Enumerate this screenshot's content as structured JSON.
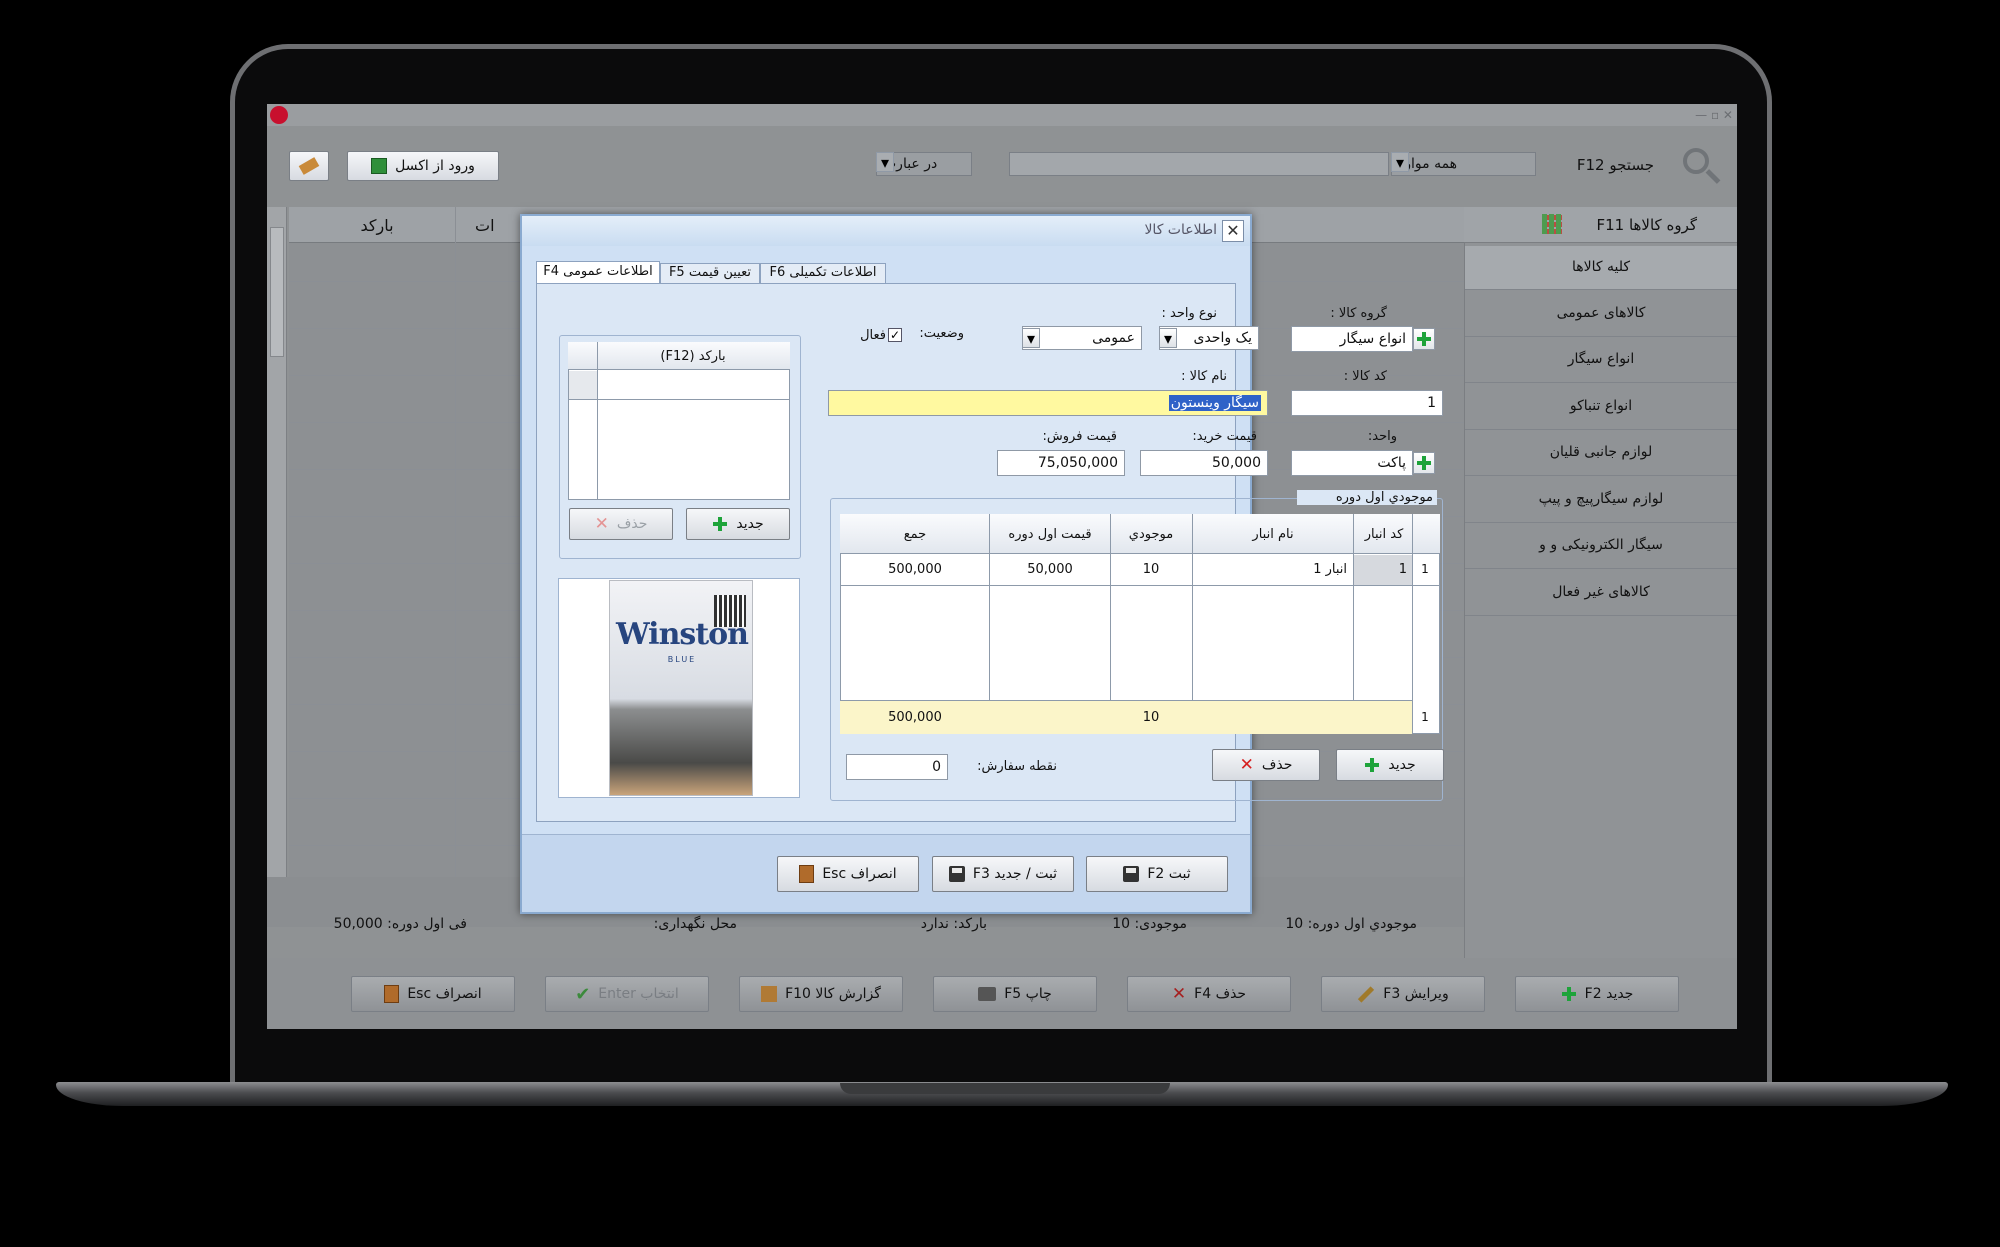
{
  "main_window": {
    "toolbar": {
      "excel_import_label": "ورود از اکسل",
      "search_label": "جستجو F12",
      "scope_value": "همه موارد",
      "match_value": "در عبارت",
      "search_value": ""
    },
    "grid_headers": [
      "بارکد",
      "ات"
    ],
    "groups_header": "گروه کالاها F11",
    "groups": [
      "کلیه کالاها",
      "کالاهای عمومی",
      "انواع سیگار",
      "انواع تنباکو",
      "لوازم جانبی قلیان",
      "لوازم سیگارپیچ و پیپ",
      "سیگار الکترونیکی و و",
      "کالاهای غیر فعال"
    ],
    "status": {
      "opening_stock": "موجودي اول دوره: 10",
      "stock": "موجودی: 10",
      "barcode": "بارکد: ندارد",
      "storage": "محل نگهداری:",
      "opening_price": "فی اول دوره: 50,000"
    },
    "buttons": {
      "new": "جدید F2",
      "edit": "ویرایش F3",
      "delete": "حذف F4",
      "print": "چاپ F5",
      "report": "گزارش کالا F10",
      "select": "انتخاب Enter",
      "cancel": "انصراف Esc"
    }
  },
  "dialog": {
    "title": "اطلاعات کالا",
    "tabs": [
      "اطلاعات عمومی F4",
      "تعیین قیمت F5",
      "اطلاعات تکمیلی F6"
    ],
    "group_label": "گروه کالا :",
    "group_value": "انواع سیگار",
    "unit_type_label": "نوع واحد :",
    "unit_type_value": "یک واحدی",
    "category_value": "عمومی",
    "status_label": "وضعیت:",
    "active_label": "فعال",
    "code_label": "کد کالا :",
    "code_value": "1",
    "name_label": "نام کالا :",
    "name_value": "سیگار وینستون",
    "unit_label": "واحد:",
    "unit_value": "پاکت",
    "buy_price_label": "قیمت خرید:",
    "buy_price_value": "50,000",
    "sell_price_label": "قیمت فروش:",
    "sell_price_value": "75,050,000",
    "opening_section_label": "موجودي اول دوره",
    "table_headers": {
      "code": "کد انبار",
      "name": "نام انبار",
      "qty": "موجودي",
      "price": "قیمت اول دوره",
      "total": "جمع"
    },
    "rows": [
      {
        "num": "1",
        "code": "1",
        "name": "انبار 1",
        "qty": "10",
        "price": "50,000",
        "total": "500,000"
      }
    ],
    "footer_row": {
      "num": "1",
      "qty": "10",
      "total": "500,000"
    },
    "reorder_label": "نقطه سفارش:",
    "reorder_value": "0",
    "stock_new_label": "جدید",
    "stock_delete_label": "حذف",
    "barcode_header": "بارکد (F12)",
    "barcode_new_label": "جدید",
    "barcode_delete_label": "حذف",
    "product_image": {
      "brand": "Winston",
      "variant": "BLUE"
    },
    "save_label": "ثبت F2",
    "save_new_label": "ثبت / جدید F3",
    "cancel_label": "انصراف Esc"
  }
}
